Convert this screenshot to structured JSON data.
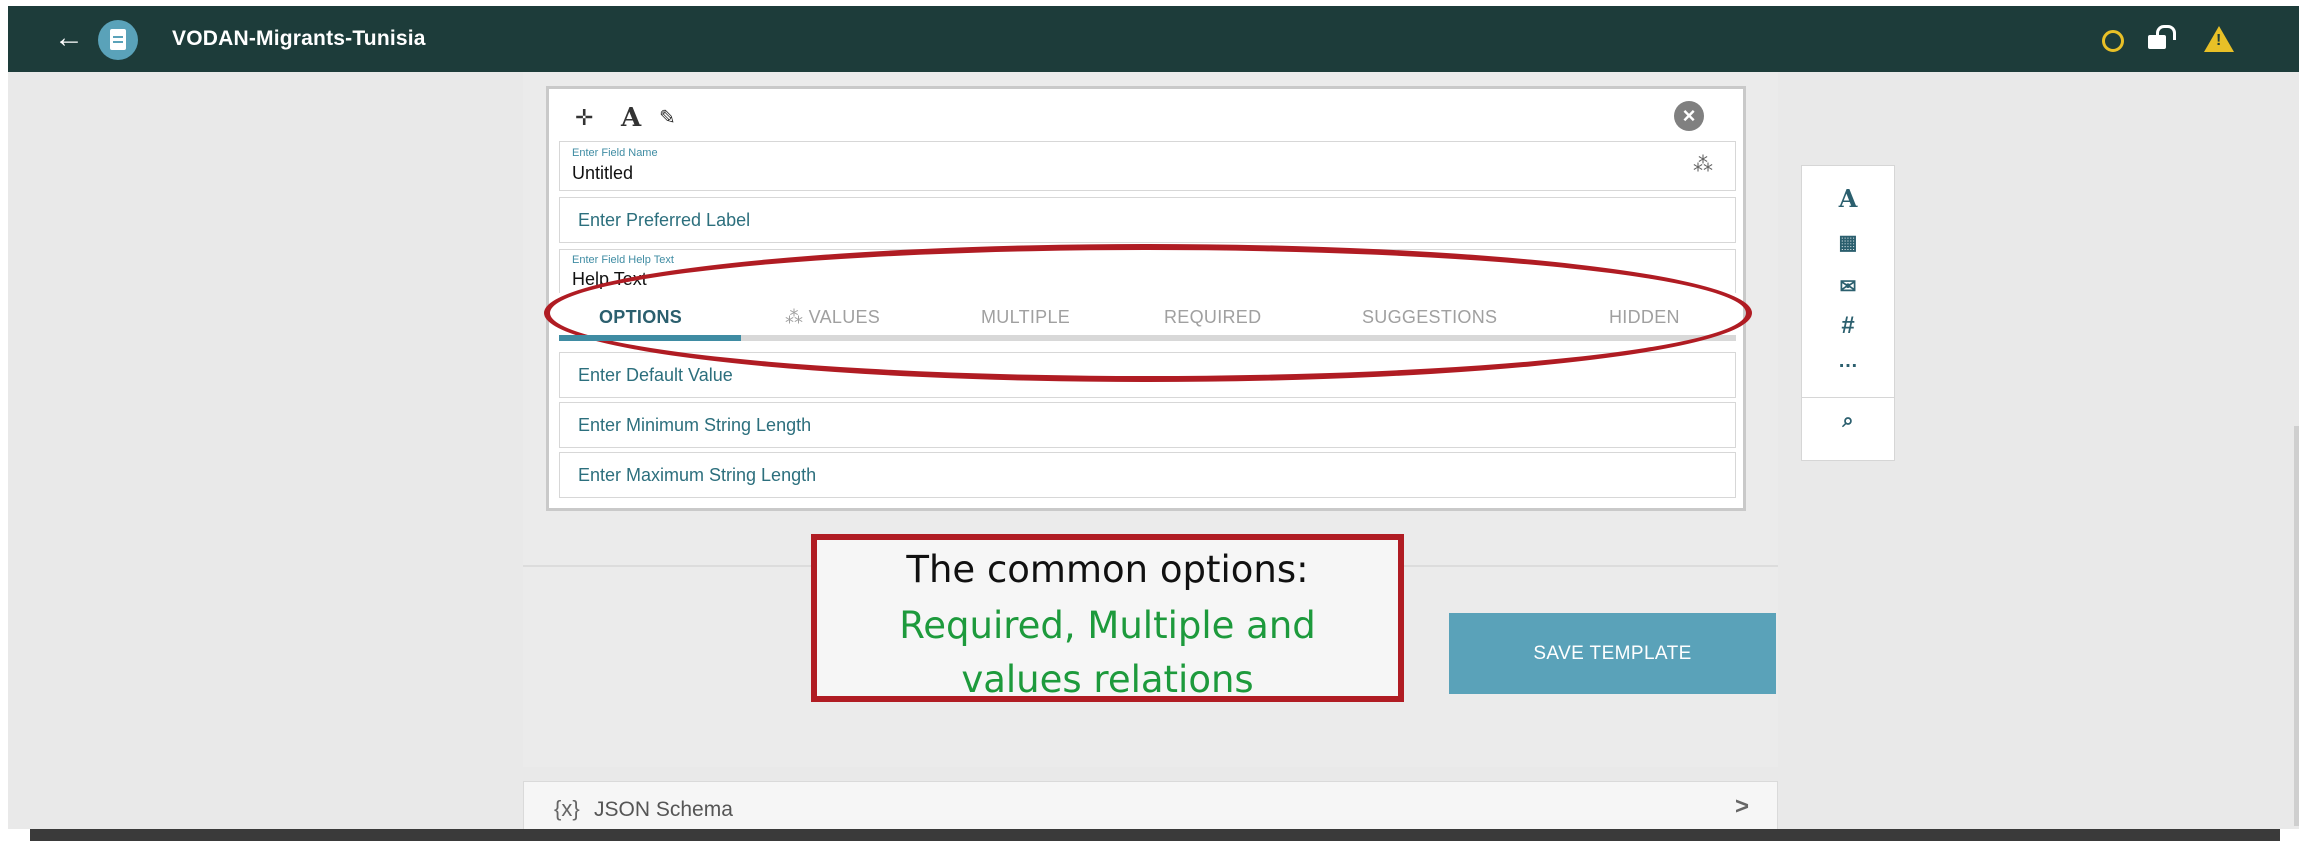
{
  "header": {
    "title": "VODAN-Migrants-Tunisia",
    "back_icon": "arrow-left-icon",
    "doc_icon": "document-icon",
    "status_icons": [
      "circle-status-icon",
      "unlock-icon",
      "warning-icon"
    ],
    "colors": {
      "bar": "#1d3c3a",
      "accent": "#5aa2b9",
      "warning": "#e8c027"
    }
  },
  "editor": {
    "field_name_label": "Enter Field Name",
    "field_name_value": "Untitled",
    "preferred_label_placeholder": "Enter Preferred Label",
    "help_label": "Enter Field Help Text",
    "help_value": "Help Text",
    "tabs": [
      {
        "label": "OPTIONS",
        "active": true
      },
      {
        "label": "VALUES",
        "active": false
      },
      {
        "label": "MULTIPLE",
        "active": false
      },
      {
        "label": "REQUIRED",
        "active": false
      },
      {
        "label": "SUGGESTIONS",
        "active": false
      },
      {
        "label": "HIDDEN",
        "active": false
      }
    ],
    "options": [
      "Enter Default Value",
      "Enter Minimum String Length",
      "Enter Maximum String Length"
    ]
  },
  "palette": {
    "items": [
      "text-icon",
      "calendar-icon",
      "email-icon",
      "number-icon",
      "more-icon",
      "search-icon"
    ]
  },
  "save_button": "SAVE TEMPLATE",
  "json_schema": {
    "icon": "{x}",
    "label": "JSON Schema",
    "chevron": ">"
  },
  "annotation": {
    "line1": "The common options:",
    "line2": "Required, Multiple and",
    "line3": "values relations",
    "colors": {
      "border": "#b01c23",
      "highlight": "#1d9a3c"
    }
  }
}
